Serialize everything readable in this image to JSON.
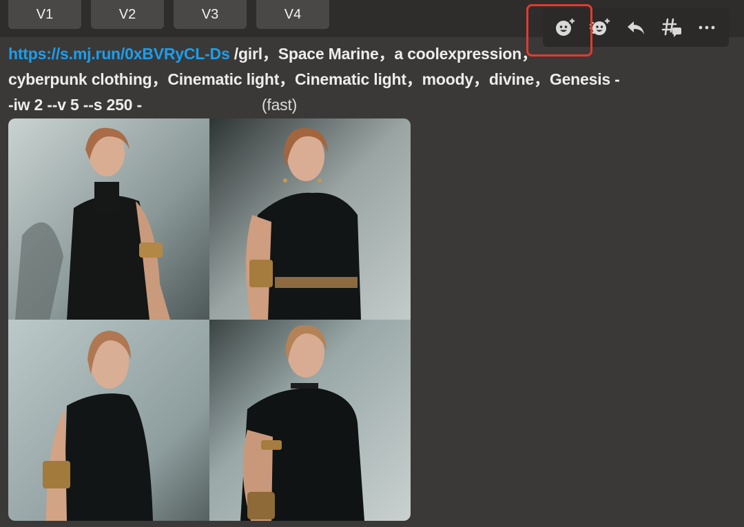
{
  "variation_buttons": [
    "V1",
    "V2",
    "V3",
    "V4"
  ],
  "toolbar": {
    "actions": [
      {
        "icon": "add-reaction-icon",
        "label": "Add Reaction"
      },
      {
        "icon": "add-super-reaction-icon",
        "label": "Add Super Reaction"
      },
      {
        "icon": "reply-icon",
        "label": "Reply"
      },
      {
        "icon": "create-thread-icon",
        "label": "Create Thread"
      },
      {
        "icon": "more-icon",
        "label": "More"
      }
    ],
    "highlight_color": "#e53a2f"
  },
  "message": {
    "link_text": "https://s.mj.run/0xBVRyCL-Ds",
    "prompt_line1": " /girl，Space Marine，a coolexpression，",
    "prompt_line2": "cyberpunk clothing，Cinematic light，Cinematic light，moody，divine，Genesis -",
    "prompt_line3": "-iw 2 --v 5 --s 250 -",
    "mode": "(fast)"
  },
  "images": [
    {
      "name": "image-1"
    },
    {
      "name": "image-2"
    },
    {
      "name": "image-3"
    },
    {
      "name": "image-4"
    }
  ],
  "colors": {
    "background": "#3b3937",
    "link": "#1a9ff0",
    "button": "#4a4846"
  }
}
